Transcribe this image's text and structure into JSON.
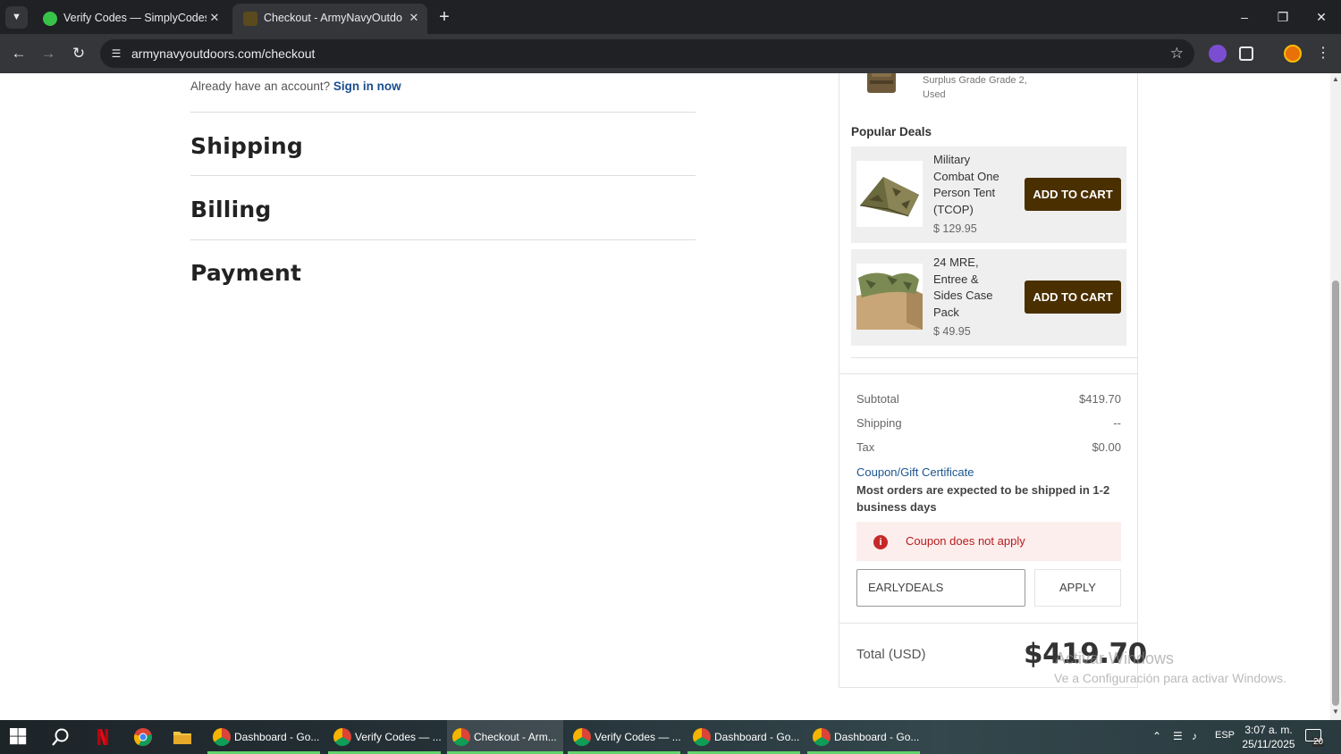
{
  "browser": {
    "tabs": [
      {
        "title": "Verify Codes — SimplyCodes",
        "active": false
      },
      {
        "title": "Checkout - ArmyNavyOutdoors",
        "active": true
      }
    ],
    "url": "armynavyoutdoors.com/checkout"
  },
  "checkout": {
    "account_prompt": "Already have an account?",
    "sign_in_link": "Sign in now",
    "sections": [
      "Shipping",
      "Billing",
      "Payment"
    ]
  },
  "summary": {
    "previous_item_text": "Surplus Grade Grade 2, Used",
    "popular_deals_title": "Popular Deals",
    "deals": [
      {
        "name": "Military Combat One Person Tent (TCOP)",
        "price": "$ 129.95",
        "button": "ADD TO CART"
      },
      {
        "name": "24 MRE, Entree & Sides Case Pack",
        "price": "$ 49.95",
        "button": "ADD TO CART"
      }
    ],
    "subtotal_label": "Subtotal",
    "subtotal_value": "$419.70",
    "shipping_label": "Shipping",
    "shipping_value": "--",
    "tax_label": "Tax",
    "tax_value": "$0.00",
    "coupon_link": "Coupon/Gift Certificate",
    "shipping_note": "Most orders are expected to be shipped in 1-2 business days",
    "coupon_error": "Coupon does not apply",
    "coupon_code": "EARLYDEALS",
    "apply_label": "APPLY",
    "total_label": "Total (USD)",
    "total_value": "$419.70"
  },
  "watermark": {
    "line1": "Activar Windows",
    "line2": "Ve a Configuración para activar Windows."
  },
  "taskbar": {
    "apps": [
      {
        "label": "Dashboard - Go...",
        "color": "#3b6fd8"
      },
      {
        "label": "Verify Codes — ...",
        "color": "#1e8e3e"
      },
      {
        "label": "Checkout - Arm...",
        "color": "#e53935"
      },
      {
        "label": "Verify Codes — ...",
        "color": "#8e24aa"
      },
      {
        "label": "Dashboard - Go...",
        "color": "#1e8e3e"
      },
      {
        "label": "Dashboard - Go...",
        "color": "#455a64"
      }
    ],
    "language": "ESP",
    "time": "3:07 a. m.",
    "date": "25/11/2025",
    "notifications": "20"
  }
}
